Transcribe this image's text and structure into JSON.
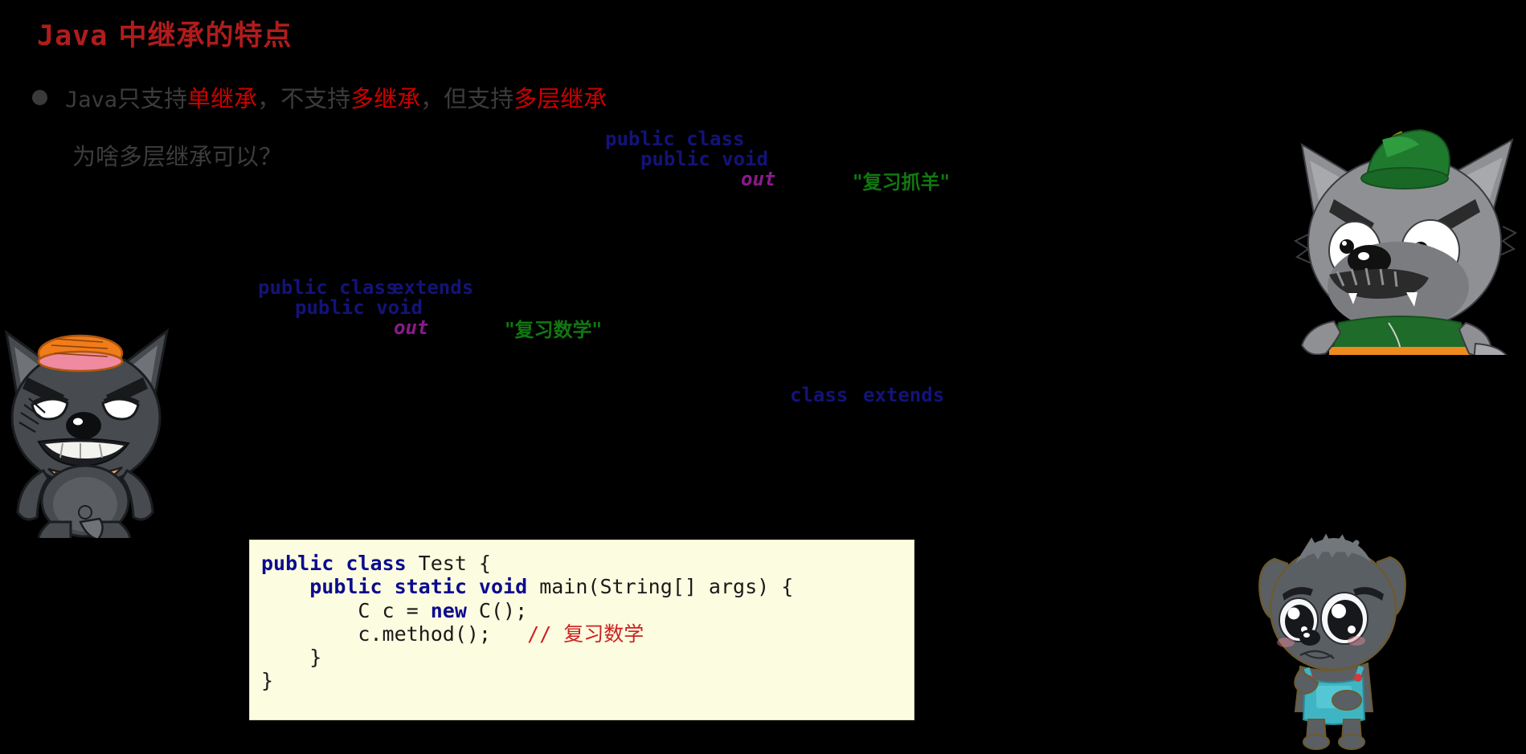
{
  "slide": {
    "background_color": "#000000",
    "title_latin": "Java",
    "title_cjk": " 中继承的特点",
    "title_color": "#b01c1c"
  },
  "bullet": {
    "marker_icon": "bullet-dot-icon",
    "marker_color": "#3a3a3a",
    "seg1_mono": "Java",
    "seg2": "只支持",
    "seg3_red": "单继承",
    "seg4": "，不支持",
    "seg5_red": "多继承",
    "seg6": "，但支持",
    "seg7_red": "多层继承",
    "base_color": "#3c3c3c",
    "highlight_color": "#cc0000"
  },
  "sub_question": {
    "text": "为啥多层继承可以？"
  },
  "fragments": {
    "block_a": {
      "line1": "public class",
      "line2": "public void",
      "out": "out",
      "string": "\"复习抓羊\""
    },
    "block_b": {
      "line1_a": "public class",
      "line1_b": "extends",
      "line2": "public void",
      "out": "out",
      "string": "\"复习数学\""
    },
    "block_c": {
      "kw_class": "class",
      "kw_extends": "extends"
    },
    "keyword_color": "#13137a",
    "out_color": "#8b1a8b",
    "string_color": "#117711"
  },
  "code_card": {
    "background_color": "#fcfce0",
    "keyword_color": "#0b0b8f",
    "comment_color": "#cc2222",
    "lines": [
      [
        {
          "t": "public class",
          "c": "ck"
        },
        {
          "t": " Test {",
          "c": "cn"
        }
      ],
      [
        {
          "t": "    ",
          "c": "cn"
        },
        {
          "t": "public static void",
          "c": "ck"
        },
        {
          "t": " main(String[] args) {",
          "c": "cn"
        }
      ],
      [
        {
          "t": "        C c = ",
          "c": "cn"
        },
        {
          "t": "new",
          "c": "ck"
        },
        {
          "t": " C();",
          "c": "cn"
        }
      ],
      [
        {
          "t": "        c.method();   ",
          "c": "cn"
        },
        {
          "t": "// ",
          "c": "cc"
        },
        {
          "t": "复习数学",
          "c": "cc-cjk"
        }
      ],
      [
        {
          "t": "    }",
          "c": "cn"
        }
      ],
      [
        {
          "t": "}",
          "c": "cn"
        }
      ]
    ]
  },
  "characters": [
    {
      "name": "wolf-green-hat",
      "description": "灰太狼 grey wolf with green hat and green vest with orange sash",
      "body_color": "#8f9094",
      "hat_color": "#1f7a2e",
      "vest_color": "#1f6b2a",
      "sash_color": "#f08a1c"
    },
    {
      "name": "wolf-orange-beret",
      "description": "dark grey wolf with orange beret and tan scarf",
      "body_color": "#474a4e",
      "hat_color": "#f07c1a",
      "scarf_color": "#e8a867"
    },
    {
      "name": "wolf-pup-sad",
      "description": "小灰灰 sad grey wolf pup with teal overalls",
      "body_color": "#5a5f64",
      "overall_color": "#3fb5c4"
    }
  ]
}
